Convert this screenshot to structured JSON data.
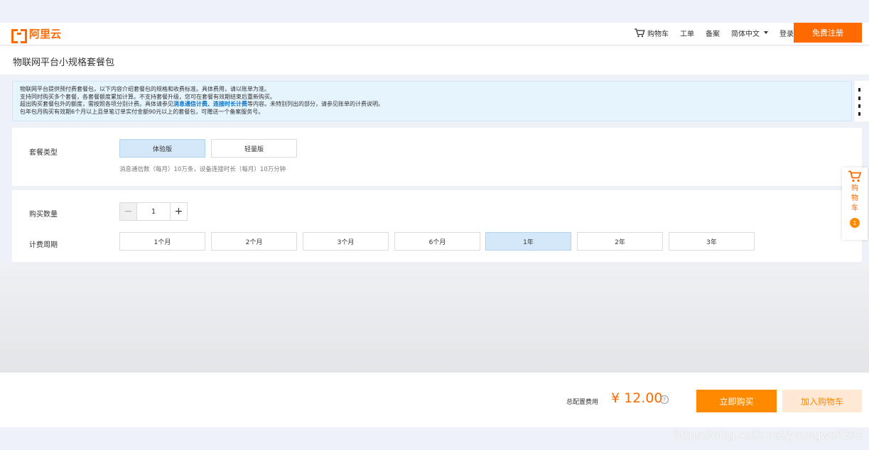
{
  "brand": {
    "name": "阿里云",
    "color": "#ff6a00",
    "icon": "aliyun-logo-icon"
  },
  "nav": {
    "items": [
      {
        "label": "购物车",
        "icon": "cart-icon"
      },
      {
        "label": "工单"
      },
      {
        "label": "备案"
      },
      {
        "label": "简体中文",
        "icon": "chevron-down-icon"
      },
      {
        "label": "登录"
      }
    ],
    "register": "免费注册"
  },
  "page": {
    "title": "物联网平台小规格套餐包"
  },
  "notice": {
    "line1": "物联网平台提供预付费套餐包，以下内容介绍套餐包的规格和收费标准。具体费用，请以账单为准。",
    "line2": "支持同时购买多个套餐，各套餐额度累加计算。不支持套餐升级，您可在套餐有效期结束后重新购买。",
    "line3_a": "超出购买套餐包外的额度，需按照各项分别计费。具体请参见",
    "line3_link1": "消息通信计费",
    "line3_sep": "、",
    "line3_link2": "连接时长计费",
    "line3_b": "等内容。未特别列出的部分，请参见账单的计费说明。",
    "line4": "包年包月购买有效期6个月以上且单笔订单实付金额90元以上的套餐包，可赠送一个备案服务号。"
  },
  "package_type": {
    "label": "套餐类型",
    "options": [
      "体验版",
      "轻量版"
    ],
    "selected": "体验版",
    "description": "消息通信数（每月）10万条，设备连接时长（每月）10万分钟"
  },
  "quantity": {
    "label": "购买数量",
    "value": "1",
    "minus": "−",
    "plus": "+"
  },
  "period": {
    "label": "计费周期",
    "options": [
      "1个月",
      "2个月",
      "3个月",
      "6个月",
      "1年",
      "2年",
      "3年"
    ],
    "selected": "1年"
  },
  "float_cart": {
    "label": "购物车",
    "count": "1"
  },
  "footer": {
    "total_label": "总配置费用",
    "price": "¥ 12.00",
    "help": "?",
    "buy": "立即购买",
    "add_cart": "加入购物车"
  },
  "watermark": "https://blog.csdn.net/youngwah292"
}
